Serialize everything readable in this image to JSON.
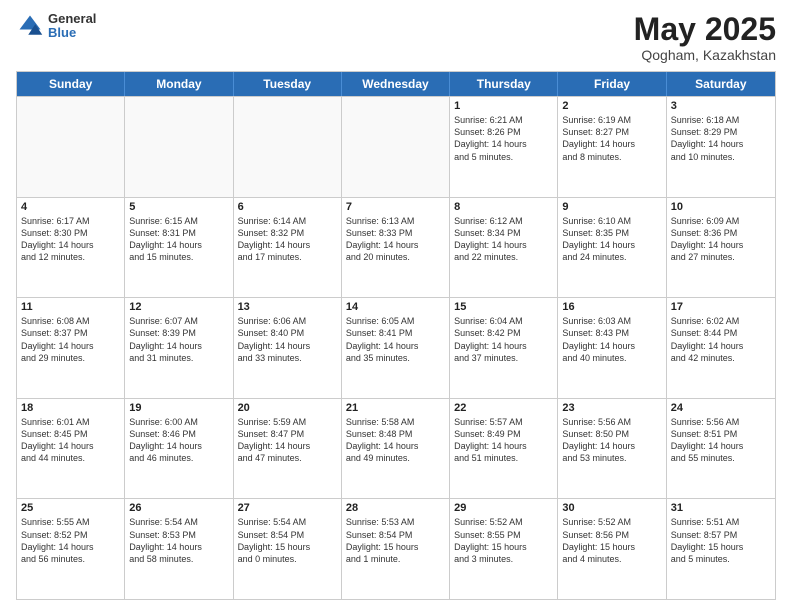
{
  "header": {
    "logo_general": "General",
    "logo_blue": "Blue",
    "title": "May 2025",
    "location": "Qogham, Kazakhstan"
  },
  "days_of_week": [
    "Sunday",
    "Monday",
    "Tuesday",
    "Wednesday",
    "Thursday",
    "Friday",
    "Saturday"
  ],
  "rows": [
    [
      {
        "day": "",
        "detail": "",
        "empty": true
      },
      {
        "day": "",
        "detail": "",
        "empty": true
      },
      {
        "day": "",
        "detail": "",
        "empty": true
      },
      {
        "day": "",
        "detail": "",
        "empty": true
      },
      {
        "day": "1",
        "detail": "Sunrise: 6:21 AM\nSunset: 8:26 PM\nDaylight: 14 hours\nand 5 minutes."
      },
      {
        "day": "2",
        "detail": "Sunrise: 6:19 AM\nSunset: 8:27 PM\nDaylight: 14 hours\nand 8 minutes."
      },
      {
        "day": "3",
        "detail": "Sunrise: 6:18 AM\nSunset: 8:29 PM\nDaylight: 14 hours\nand 10 minutes."
      }
    ],
    [
      {
        "day": "4",
        "detail": "Sunrise: 6:17 AM\nSunset: 8:30 PM\nDaylight: 14 hours\nand 12 minutes."
      },
      {
        "day": "5",
        "detail": "Sunrise: 6:15 AM\nSunset: 8:31 PM\nDaylight: 14 hours\nand 15 minutes."
      },
      {
        "day": "6",
        "detail": "Sunrise: 6:14 AM\nSunset: 8:32 PM\nDaylight: 14 hours\nand 17 minutes."
      },
      {
        "day": "7",
        "detail": "Sunrise: 6:13 AM\nSunset: 8:33 PM\nDaylight: 14 hours\nand 20 minutes."
      },
      {
        "day": "8",
        "detail": "Sunrise: 6:12 AM\nSunset: 8:34 PM\nDaylight: 14 hours\nand 22 minutes."
      },
      {
        "day": "9",
        "detail": "Sunrise: 6:10 AM\nSunset: 8:35 PM\nDaylight: 14 hours\nand 24 minutes."
      },
      {
        "day": "10",
        "detail": "Sunrise: 6:09 AM\nSunset: 8:36 PM\nDaylight: 14 hours\nand 27 minutes."
      }
    ],
    [
      {
        "day": "11",
        "detail": "Sunrise: 6:08 AM\nSunset: 8:37 PM\nDaylight: 14 hours\nand 29 minutes."
      },
      {
        "day": "12",
        "detail": "Sunrise: 6:07 AM\nSunset: 8:39 PM\nDaylight: 14 hours\nand 31 minutes."
      },
      {
        "day": "13",
        "detail": "Sunrise: 6:06 AM\nSunset: 8:40 PM\nDaylight: 14 hours\nand 33 minutes."
      },
      {
        "day": "14",
        "detail": "Sunrise: 6:05 AM\nSunset: 8:41 PM\nDaylight: 14 hours\nand 35 minutes."
      },
      {
        "day": "15",
        "detail": "Sunrise: 6:04 AM\nSunset: 8:42 PM\nDaylight: 14 hours\nand 37 minutes."
      },
      {
        "day": "16",
        "detail": "Sunrise: 6:03 AM\nSunset: 8:43 PM\nDaylight: 14 hours\nand 40 minutes."
      },
      {
        "day": "17",
        "detail": "Sunrise: 6:02 AM\nSunset: 8:44 PM\nDaylight: 14 hours\nand 42 minutes."
      }
    ],
    [
      {
        "day": "18",
        "detail": "Sunrise: 6:01 AM\nSunset: 8:45 PM\nDaylight: 14 hours\nand 44 minutes."
      },
      {
        "day": "19",
        "detail": "Sunrise: 6:00 AM\nSunset: 8:46 PM\nDaylight: 14 hours\nand 46 minutes."
      },
      {
        "day": "20",
        "detail": "Sunrise: 5:59 AM\nSunset: 8:47 PM\nDaylight: 14 hours\nand 47 minutes."
      },
      {
        "day": "21",
        "detail": "Sunrise: 5:58 AM\nSunset: 8:48 PM\nDaylight: 14 hours\nand 49 minutes."
      },
      {
        "day": "22",
        "detail": "Sunrise: 5:57 AM\nSunset: 8:49 PM\nDaylight: 14 hours\nand 51 minutes."
      },
      {
        "day": "23",
        "detail": "Sunrise: 5:56 AM\nSunset: 8:50 PM\nDaylight: 14 hours\nand 53 minutes."
      },
      {
        "day": "24",
        "detail": "Sunrise: 5:56 AM\nSunset: 8:51 PM\nDaylight: 14 hours\nand 55 minutes."
      }
    ],
    [
      {
        "day": "25",
        "detail": "Sunrise: 5:55 AM\nSunset: 8:52 PM\nDaylight: 14 hours\nand 56 minutes."
      },
      {
        "day": "26",
        "detail": "Sunrise: 5:54 AM\nSunset: 8:53 PM\nDaylight: 14 hours\nand 58 minutes."
      },
      {
        "day": "27",
        "detail": "Sunrise: 5:54 AM\nSunset: 8:54 PM\nDaylight: 15 hours\nand 0 minutes."
      },
      {
        "day": "28",
        "detail": "Sunrise: 5:53 AM\nSunset: 8:54 PM\nDaylight: 15 hours\nand 1 minute."
      },
      {
        "day": "29",
        "detail": "Sunrise: 5:52 AM\nSunset: 8:55 PM\nDaylight: 15 hours\nand 3 minutes."
      },
      {
        "day": "30",
        "detail": "Sunrise: 5:52 AM\nSunset: 8:56 PM\nDaylight: 15 hours\nand 4 minutes."
      },
      {
        "day": "31",
        "detail": "Sunrise: 5:51 AM\nSunset: 8:57 PM\nDaylight: 15 hours\nand 5 minutes."
      }
    ]
  ]
}
